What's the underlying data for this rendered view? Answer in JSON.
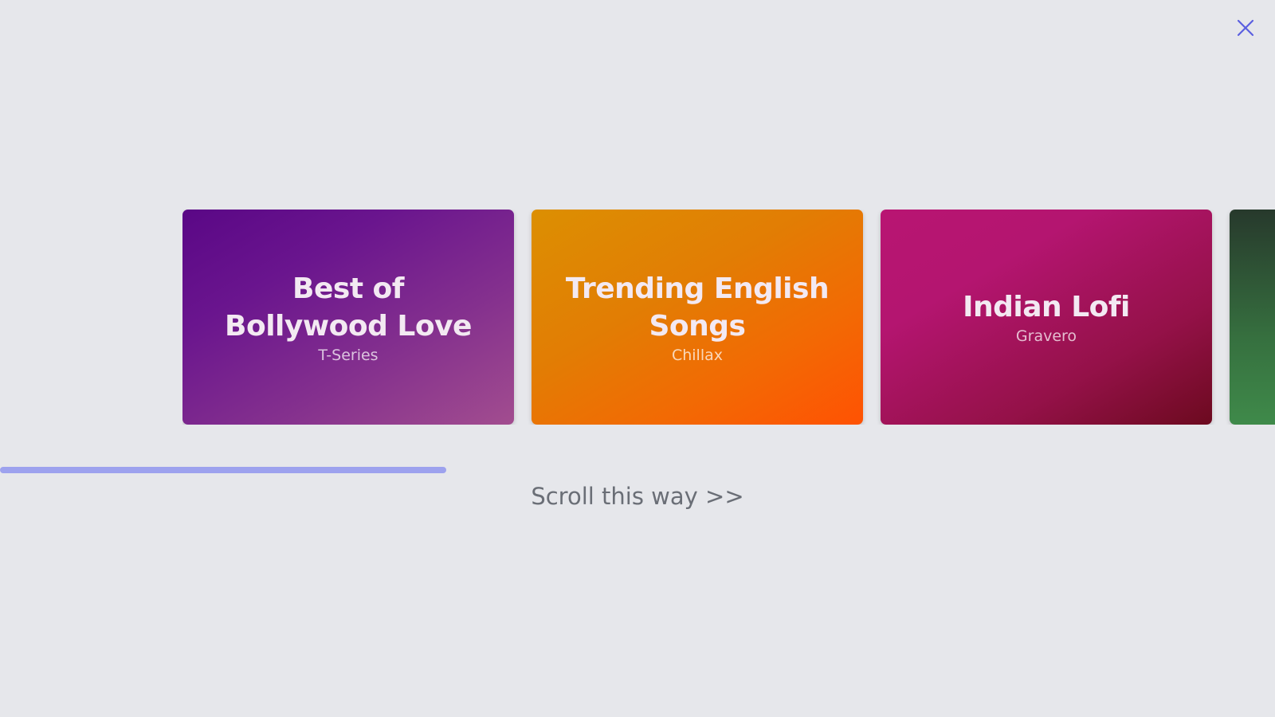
{
  "carousel": {
    "cards": [
      {
        "title": "Best of Bollywood Love",
        "artist": "T-Series"
      },
      {
        "title": "Trending English Songs",
        "artist": "Chillax"
      },
      {
        "title": "Indian Lofi",
        "artist": "Gravero"
      },
      {
        "title": "",
        "artist": ""
      }
    ]
  },
  "scroll": {
    "hint": "Scroll this way >>",
    "progress_fraction": 0.35
  },
  "icons": {
    "close": "close-icon"
  },
  "colors": {
    "background": "#e6e7eb",
    "accent": "#6366f1",
    "progress": "#9da2ee"
  }
}
